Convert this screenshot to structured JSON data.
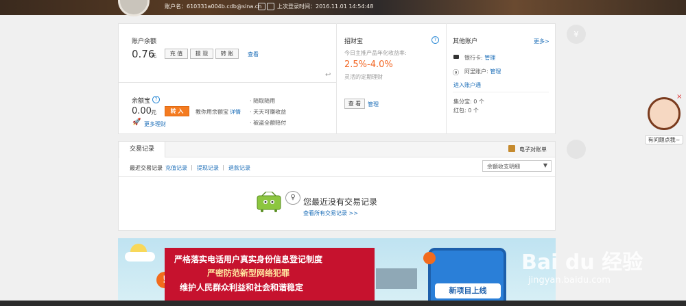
{
  "header": {
    "account_label": "账户名：",
    "account_value": "610331a004b.cdb@sina.cn",
    "last_login_label": "上次登录时间：",
    "last_login_value": "2016.11.01 14:54:48"
  },
  "balance": {
    "title": "账户余额",
    "amount": "0.76",
    "unit": "元",
    "recharge": "充 值",
    "withdraw": "提 现",
    "transfer": "转 账",
    "view": "查看"
  },
  "yuebao": {
    "title": "余额宝",
    "amount": "0.00",
    "unit": "元",
    "transfer_in": "转 入",
    "tutorial": "教你用余额宝",
    "detail": "详情",
    "more": "更多理财",
    "features": [
      "随取随用",
      "天天可赚收益",
      "被盗全额赔付"
    ]
  },
  "zhaocaibao": {
    "title": "招财宝",
    "subtitle": "今日主推产品年化收益率:",
    "rate": "2.5%-4.0%",
    "desc": "灵活的定期理财",
    "view": "查 看",
    "manage": "管理"
  },
  "other": {
    "title": "其他账户",
    "more": "更多>",
    "bank_label": "银行卡:",
    "bank_manage": "管理",
    "alimama_label": "阿里账户:",
    "alimama_manage": "管理",
    "enter": "进入账户通",
    "jifen": "集分宝: 0 个",
    "hongbao": "红包: 0 个"
  },
  "records": {
    "tab": "交易记录",
    "ebill": "电子对账单",
    "subtabs": [
      "最近交易记录",
      "充值记录",
      "提现记录",
      "退款记录"
    ],
    "separator": "|",
    "select_value": "余额收支明细",
    "empty": "您最近没有交易记录",
    "view_all": "查看所有交易记录 >>"
  },
  "banner": {
    "line1": "严格落实电话用户真实身份信息登记制度",
    "line2": "严密防范新型网络犯罪",
    "line3": "维护人民群众利益和社会和谐稳定",
    "phone_text": "新项目上线"
  },
  "help": {
    "label": "有问题点我~",
    "close": "×",
    "side_icon": "¥"
  },
  "watermark": {
    "brand": "Bai du 经验",
    "url": "jingyan.baidu.com"
  },
  "colors": {
    "accent_orange": "#f47b20",
    "link_blue": "#1e6fb8",
    "rate_orange": "#f26522"
  }
}
